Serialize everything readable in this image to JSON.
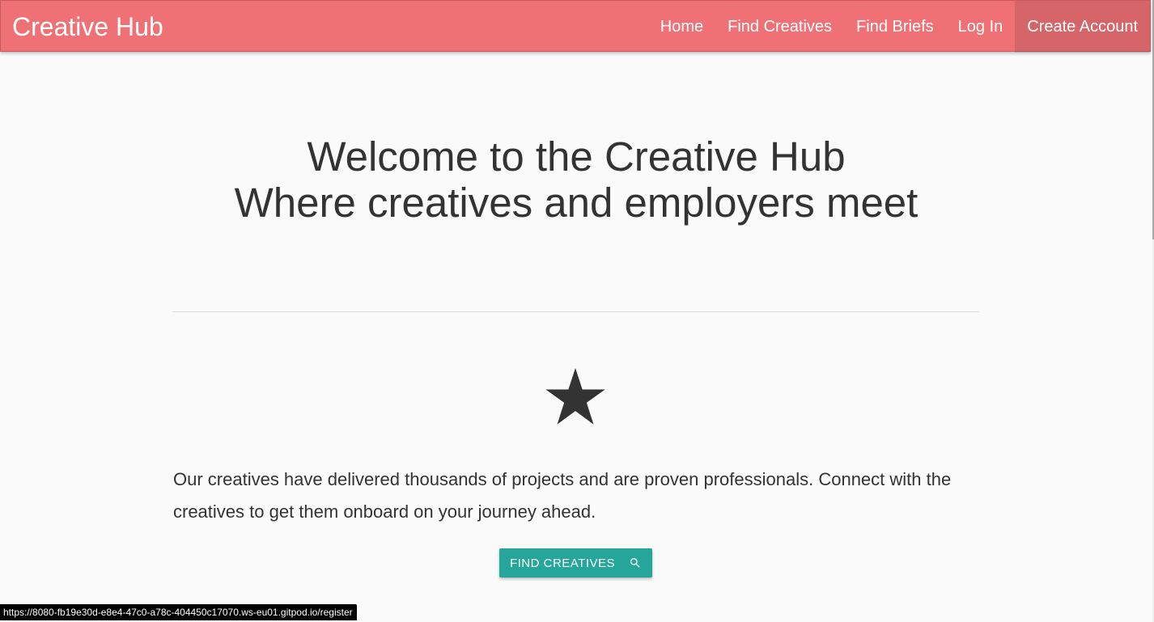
{
  "navbar": {
    "brand": "Creative Hub",
    "links": [
      {
        "label": "Home"
      },
      {
        "label": "Find Creatives"
      },
      {
        "label": "Find Briefs"
      },
      {
        "label": "Log In"
      },
      {
        "label": "Create Account",
        "active": true
      }
    ],
    "background_color": "#ef7175"
  },
  "hero": {
    "line1": "Welcome to the Creative Hub",
    "line2": "Where creatives and employers meet"
  },
  "feature": {
    "icon": "star-icon",
    "description": "Our creatives have delivered thousands of projects and are proven professionals. Connect with the creatives to get them onboard on your journey ahead."
  },
  "cta": {
    "label": "FIND CREATIVES",
    "icon": "search-icon",
    "color": "#26a69a"
  },
  "status_bar": {
    "url": "https://8080-fb19e30d-e8e4-47c0-a78c-404450c17070.ws-eu01.gitpod.io/register"
  }
}
